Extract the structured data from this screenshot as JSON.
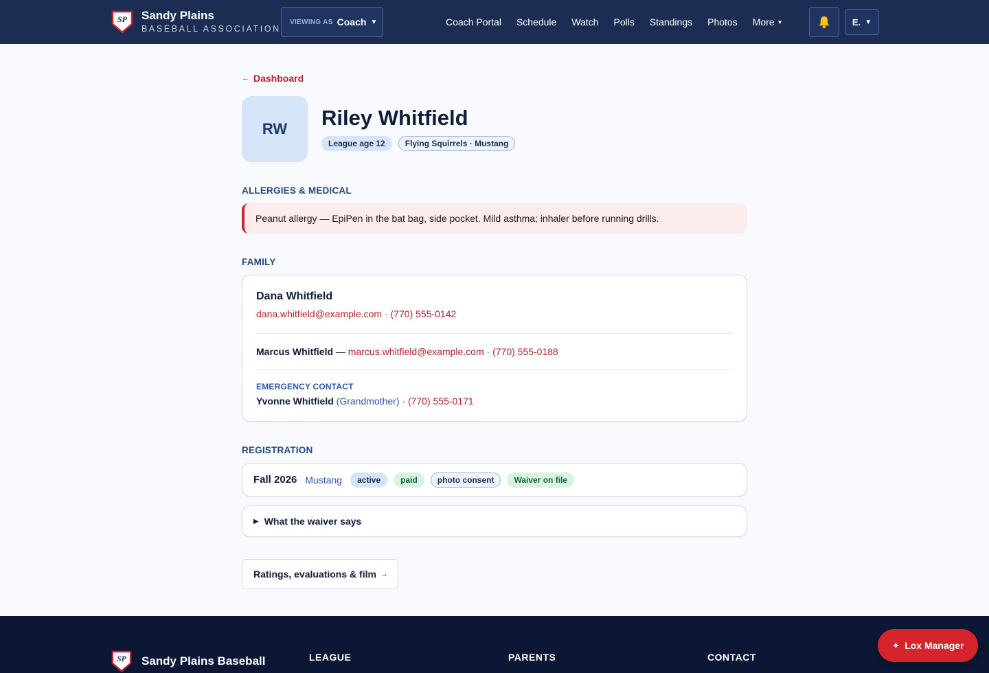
{
  "header": {
    "logo_initials": "SP",
    "brand_name": "Sandy Plains",
    "brand_sub": "BASEBALL ASSOCIATION",
    "viewing_as_label": "VIEWING AS",
    "viewing_as_value": "Coach",
    "nav": [
      "Coach Portal",
      "Schedule",
      "Watch",
      "Polls",
      "Standings",
      "Photos",
      "More"
    ],
    "bell_icon": "bell-icon",
    "user_initial": "E."
  },
  "profile": {
    "back_label": "Dashboard",
    "initials": "RW",
    "name": "Riley Whitfield",
    "tags": [
      "League age 12",
      "Flying Squirrels · Mustang"
    ]
  },
  "medical": {
    "title": "ALLERGIES & MEDICAL",
    "note": "Peanut allergy — EpiPen in the bat bag, side pocket. Mild asthma; inhaler before running drills."
  },
  "family": {
    "title": "FAMILY",
    "primary": {
      "name": "Dana Whitfield",
      "email": "dana.whitfield@example.com",
      "phone": "(770) 555-0142"
    },
    "secondary": {
      "name": "Marcus Whitfield",
      "email": "marcus.whitfield@example.com",
      "phone": "(770) 555-0188"
    },
    "emergency": {
      "label": "EMERGENCY CONTACT",
      "name": "Yvonne Whitfield",
      "relation": "(Grandmother)",
      "phone": "(770) 555-0171"
    }
  },
  "registration": {
    "title": "REGISTRATION",
    "term": "Fall 2026",
    "team": "Mustang",
    "badges": [
      "active",
      "paid",
      "photo consent",
      "Waiver on file"
    ],
    "waiver_toggle": "What the waiver says",
    "ratings_button": "Ratings, evaluations & film"
  },
  "footer": {
    "brand_name": "Sandy Plains Baseball",
    "columns": [
      "LEAGUE",
      "PARENTS",
      "CONTACT"
    ]
  },
  "assistant": {
    "label": "Lox Manager"
  },
  "colors": {
    "navy": "#1b2d52",
    "accent_red": "#b8232e",
    "footer": "#0b1734"
  }
}
